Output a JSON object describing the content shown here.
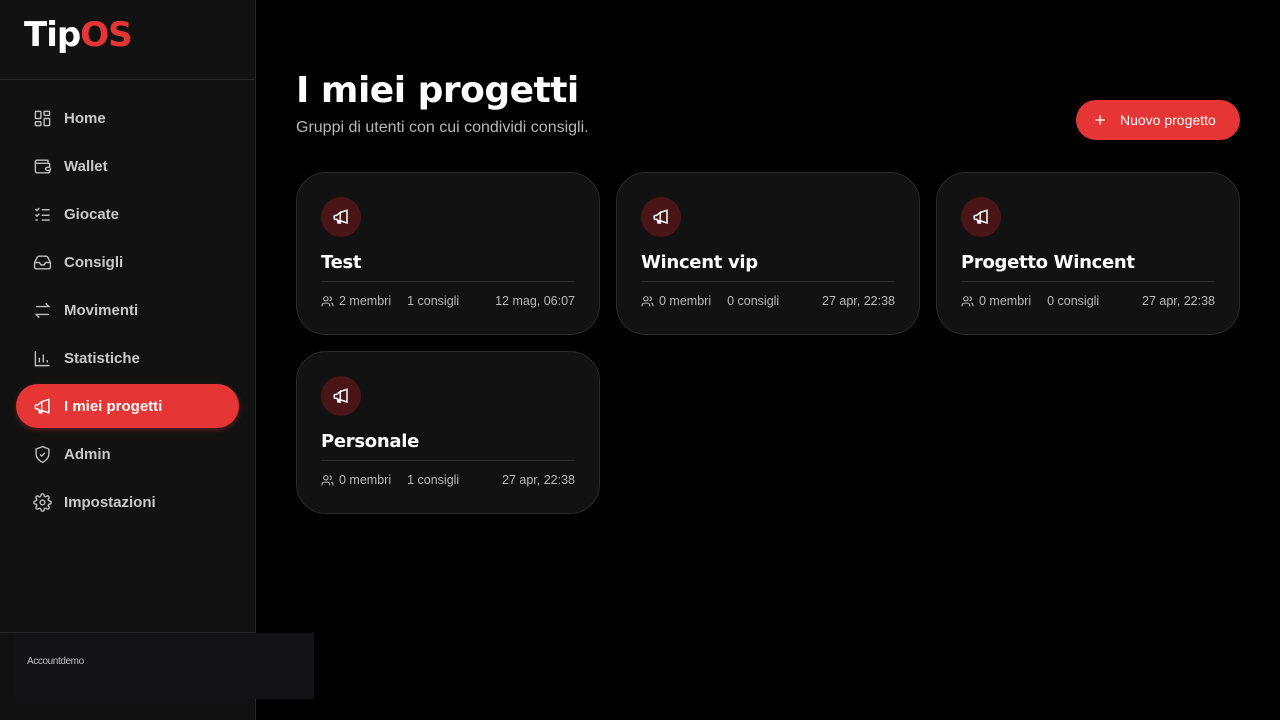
{
  "brand": {
    "part1": "Tip",
    "part2": "OS"
  },
  "colors": {
    "accent": "#e53535",
    "background": "#000000",
    "sidebar": "#121212",
    "card": "#121212",
    "badge": "#4a1516"
  },
  "sidebar": {
    "items": [
      {
        "label": "Home",
        "icon": "grid-icon"
      },
      {
        "label": "Wallet",
        "icon": "wallet-icon"
      },
      {
        "label": "Giocate",
        "icon": "checklist-icon"
      },
      {
        "label": "Consigli",
        "icon": "inbox-icon"
      },
      {
        "label": "Movimenti",
        "icon": "transfer-arrows-icon"
      },
      {
        "label": "Statistiche",
        "icon": "bar-chart-icon"
      },
      {
        "label": "I miei progetti",
        "icon": "megaphone-icon",
        "active": true
      },
      {
        "label": "Admin",
        "icon": "shield-check-icon"
      },
      {
        "label": "Impostazioni",
        "icon": "gear-icon"
      }
    ],
    "account_label": "Accountdemo"
  },
  "header": {
    "title": "I miei progetti",
    "subtitle": "Gruppi di utenti con cui condividi consigli.",
    "new_button_label": "Nuovo progetto"
  },
  "projects": [
    {
      "name": "Test",
      "members": "2 membri",
      "tips": "1 consigli",
      "date": "12 mag, 06:07"
    },
    {
      "name": "Wincent vip",
      "members": "0 membri",
      "tips": "0 consigli",
      "date": "27 apr, 22:38"
    },
    {
      "name": "Progetto Wincent",
      "members": "0 membri",
      "tips": "0 consigli",
      "date": "27 apr, 22:38"
    },
    {
      "name": "Personale",
      "members": "0 membri",
      "tips": "1 consigli",
      "date": "27 apr, 22:38"
    }
  ]
}
